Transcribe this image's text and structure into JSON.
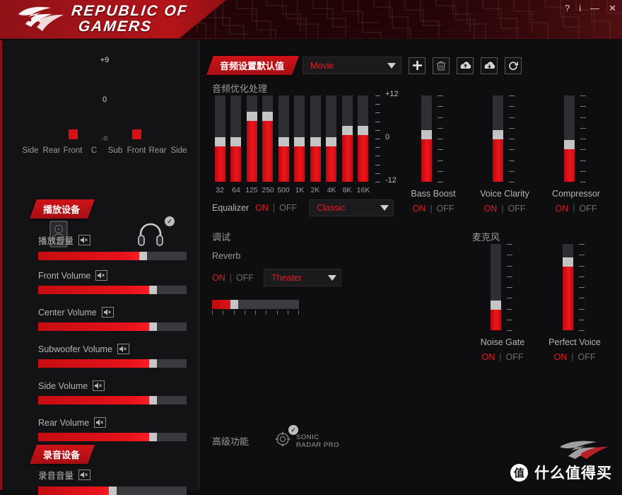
{
  "window": {
    "brand_line1": "REPUBLIC OF",
    "brand_line2": "GAMERS",
    "controls": {
      "help": "?",
      "info": "i",
      "minimize": "—",
      "close": "✕"
    }
  },
  "sidebar": {
    "meter": {
      "scale_top": "+9",
      "scale_mid": "0",
      "scale_bottom": "-6",
      "channels": [
        "Side",
        "Rear",
        "Front",
        "C",
        "Sub",
        "Front",
        "Rear",
        "Side"
      ],
      "levels": [
        0,
        0,
        14,
        0,
        0,
        14,
        0,
        0
      ]
    },
    "playback_tag": "播放设备",
    "devices": [
      {
        "name": "Speakers",
        "icon": "speaker-icon",
        "active": false,
        "checked": false
      },
      {
        "name": "Headphones",
        "icon": "headphones-icon",
        "active": true,
        "checked": true
      }
    ],
    "sliders": [
      {
        "label": "播放音量",
        "value": 72
      },
      {
        "label": "Front Volume",
        "value": 79
      },
      {
        "label": "Center Volume",
        "value": 79
      },
      {
        "label": "Subwoofer Volume",
        "value": 79
      },
      {
        "label": "Side Volume",
        "value": 79
      },
      {
        "label": "Rear Volume",
        "value": 79
      }
    ],
    "record_tag": "录音设备",
    "record_slider": {
      "label": "录音音量",
      "value": 50
    }
  },
  "main": {
    "defaults_tag": "音频设置默认值",
    "preset": {
      "value": "Movie"
    },
    "toolbar_buttons": [
      {
        "name": "add-preset-button",
        "icon": "plus-icon"
      },
      {
        "name": "delete-preset-button",
        "icon": "trash-icon"
      },
      {
        "name": "import-preset-button",
        "icon": "import-icon"
      },
      {
        "name": "export-preset-button",
        "icon": "export-icon"
      },
      {
        "name": "reset-preset-button",
        "icon": "refresh-icon"
      }
    ],
    "enhancement_title": "音频优化处理",
    "equalizer": {
      "label": "Equalizer",
      "on": "ON",
      "off": "OFF",
      "state": "ON",
      "preset": "Classic",
      "frequencies": [
        "32",
        "64",
        "125",
        "250",
        "500",
        "1K",
        "2K",
        "4K",
        "8K",
        "16K"
      ],
      "gains": [
        -1.5,
        -1.5,
        5.5,
        5.5,
        -1.5,
        -1.5,
        -1.5,
        -1.5,
        1.5,
        1.5
      ],
      "scale_labels": [
        "+12",
        "0",
        "-12"
      ],
      "range": [
        -12,
        12
      ]
    },
    "effects": [
      {
        "name": "Bass Boost",
        "value": 52,
        "on": "ON",
        "off": "OFF",
        "state": "ON"
      },
      {
        "name": "Voice Clarity",
        "value": 52,
        "on": "ON",
        "off": "OFF",
        "state": "ON"
      },
      {
        "name": "Compressor",
        "value": 40,
        "on": "ON",
        "off": "OFF",
        "state": "ON"
      }
    ],
    "tuning_title": "调试",
    "reverb": {
      "label": "Reverb",
      "on": "ON",
      "off": "OFF",
      "state": "ON",
      "preset": "Theater",
      "level": 23
    },
    "mic_title": "麦克风",
    "mic_effects": [
      {
        "name": "Noise Gate",
        "value": 26,
        "on": "ON",
        "off": "OFF",
        "state": "ON"
      },
      {
        "name": "Perfect Voice",
        "value": 76,
        "on": "ON",
        "off": "OFF",
        "state": "ON"
      }
    ],
    "advanced_title": "高级功能",
    "sonic_radar": {
      "line1": "SONIC",
      "line2": "RADAR PRO",
      "checked": true
    }
  },
  "watermark": {
    "badge": "值",
    "text": "什么值得买"
  },
  "colors": {
    "accent": "#e31b21",
    "red_bar": "#e8121a",
    "panel": "#0e0e10",
    "sidebar": "#131316"
  }
}
